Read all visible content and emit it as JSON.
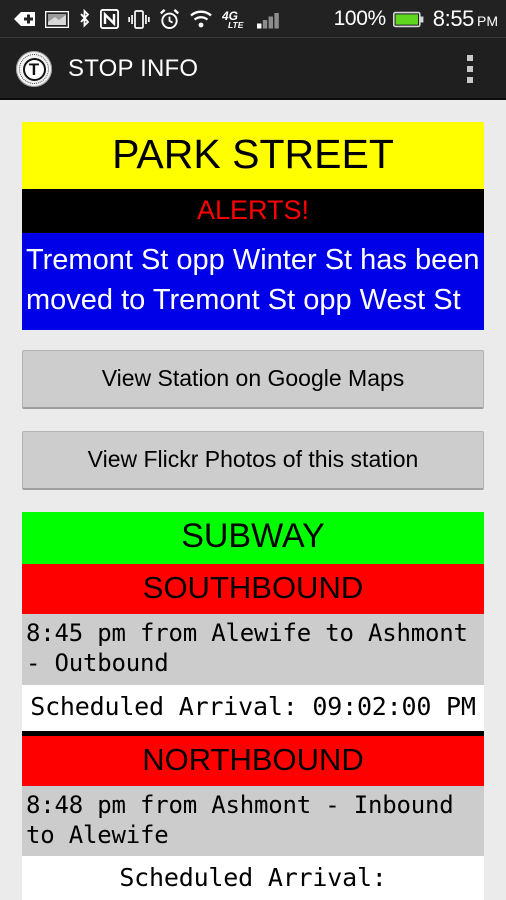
{
  "status_bar": {
    "icons": [
      {
        "name": "back-arrow-plus-icon"
      },
      {
        "name": "screenshot-image-icon"
      },
      {
        "name": "bluetooth-icon"
      },
      {
        "name": "nfc-icon"
      },
      {
        "name": "vibrate-mode-icon"
      },
      {
        "name": "alarm-clock-icon"
      },
      {
        "name": "wifi-icon"
      },
      {
        "name": "4g-lte-icon"
      },
      {
        "name": "cell-signal-icon"
      }
    ],
    "battery_percent": "100%",
    "battery_icon": "battery-full-icon",
    "clock": "8:55",
    "clock_ampm": "PM",
    "network_label": "4G",
    "network_sublabel": "LTE"
  },
  "action_bar": {
    "logo_icon": "mbta-t-logo-icon",
    "logo_letter": "T",
    "title": "STOP INFO",
    "overflow_icon": "overflow-menu-icon"
  },
  "station": {
    "name": "PARK STREET",
    "alerts_title": "ALERTS!",
    "alert_message": "Tremont St opp Winter St has been moved to Tremont St opp West St"
  },
  "buttons": {
    "google_maps": "View Station on Google Maps",
    "flickr": "View Flickr Photos of this station"
  },
  "subway": {
    "header": "SUBWAY",
    "directions": [
      {
        "label": "SOUTHBOUND",
        "trip": "8:45 pm from Alewife to Ashmont - Outbound",
        "arrival": "Scheduled Arrival: 09:02:00 PM"
      },
      {
        "label": "NORTHBOUND",
        "trip": "8:48 pm from Ashmont - Inbound to Alewife",
        "arrival": "Scheduled Arrival:"
      }
    ]
  },
  "colors": {
    "station_banner_bg": "#ffff00",
    "alerts_bg": "#000000",
    "alerts_text": "#ff0000",
    "alert_message_bg": "#0000e8",
    "subway_bg": "#00ff00",
    "direction_bg": "#ff0000",
    "trip_row_bg": "#cccccc",
    "arrival_row_bg": "#ffffff",
    "page_bg": "#ebebeb",
    "action_bar_bg": "#1f1f1f"
  }
}
